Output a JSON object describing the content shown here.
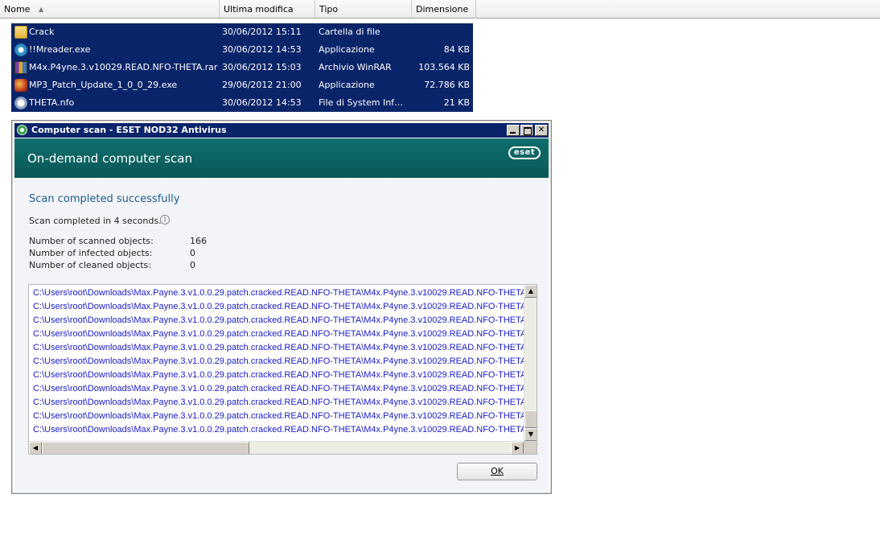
{
  "explorer": {
    "columns": [
      {
        "label": "Nome"
      },
      {
        "label": "Ultima modifica"
      },
      {
        "label": "Tipo"
      },
      {
        "label": "Dimensione"
      },
      {
        "label": ""
      }
    ],
    "files": [
      {
        "icon": "folder-icon",
        "name": "Crack",
        "date": "30/06/2012 15:11",
        "type": "Cartella di file",
        "size": ""
      },
      {
        "icon": "exe-icon",
        "name": "!!Mreader.exe",
        "date": "30/06/2012 14:53",
        "type": "Applicazione",
        "size": "84 KB"
      },
      {
        "icon": "winrar-icon",
        "name": "M4x.P4yne.3.v10029.READ.NFO-THETA.rar",
        "date": "30/06/2012 15:03",
        "type": "Archivio WinRAR",
        "size": "103.564 KB"
      },
      {
        "icon": "patch-exe-icon",
        "name": "MP3_Patch_Update_1_0_0_29.exe",
        "date": "29/06/2012 21:00",
        "type": "Applicazione",
        "size": "72.786 KB"
      },
      {
        "icon": "nfo-icon",
        "name": "THETA.nfo",
        "date": "30/06/2012 14:53",
        "type": "File di System Infor…",
        "size": "21 KB"
      }
    ]
  },
  "window": {
    "title": "Computer scan - ESET NOD32 Antivirus",
    "banner_title": "On-demand computer scan",
    "logo_text": "eset",
    "status_heading": "Scan completed successfully",
    "scan_time": "Scan completed in 4 seconds.",
    "stats": [
      {
        "label": "Number of scanned objects:",
        "value": "166"
      },
      {
        "label": "Number of infected objects:",
        "value": "0"
      },
      {
        "label": "Number of cleaned objects:",
        "value": "0"
      }
    ],
    "log_lines": [
      "C:\\Users\\root\\Downloads\\Max.Payne.3.v1.0.0.29.patch.cracked.READ.NFO-THETA\\M4x.P4yne.3.v10029.READ.NFO-THETA.",
      "C:\\Users\\root\\Downloads\\Max.Payne.3.v1.0.0.29.patch.cracked.READ.NFO-THETA\\M4x.P4yne.3.v10029.READ.NFO-THETA.",
      "C:\\Users\\root\\Downloads\\Max.Payne.3.v1.0.0.29.patch.cracked.READ.NFO-THETA\\M4x.P4yne.3.v10029.READ.NFO-THETA.",
      "C:\\Users\\root\\Downloads\\Max.Payne.3.v1.0.0.29.patch.cracked.READ.NFO-THETA\\M4x.P4yne.3.v10029.READ.NFO-THETA.",
      "C:\\Users\\root\\Downloads\\Max.Payne.3.v1.0.0.29.patch.cracked.READ.NFO-THETA\\M4x.P4yne.3.v10029.READ.NFO-THETA.",
      "C:\\Users\\root\\Downloads\\Max.Payne.3.v1.0.0.29.patch.cracked.READ.NFO-THETA\\M4x.P4yne.3.v10029.READ.NFO-THETA.",
      "C:\\Users\\root\\Downloads\\Max.Payne.3.v1.0.0.29.patch.cracked.READ.NFO-THETA\\M4x.P4yne.3.v10029.READ.NFO-THETA.",
      "C:\\Users\\root\\Downloads\\Max.Payne.3.v1.0.0.29.patch.cracked.READ.NFO-THETA\\M4x.P4yne.3.v10029.READ.NFO-THETA.",
      "C:\\Users\\root\\Downloads\\Max.Payne.3.v1.0.0.29.patch.cracked.READ.NFO-THETA\\M4x.P4yne.3.v10029.READ.NFO-THETA.",
      "C:\\Users\\root\\Downloads\\Max.Payne.3.v1.0.0.29.patch.cracked.READ.NFO-THETA\\M4x.P4yne.3.v10029.READ.NFO-THETA.",
      "C:\\Users\\root\\Downloads\\Max.Payne.3.v1.0.0.29.patch.cracked.READ.NFO-THETA\\M4x.P4yne.3.v10029.READ.NFO-THETA."
    ],
    "ok_label": "OK"
  },
  "colors": {
    "selection": "#0a246a",
    "banner": "#0e6e6c",
    "heading": "#1f5a8f",
    "log_text": "#1a1acc"
  }
}
